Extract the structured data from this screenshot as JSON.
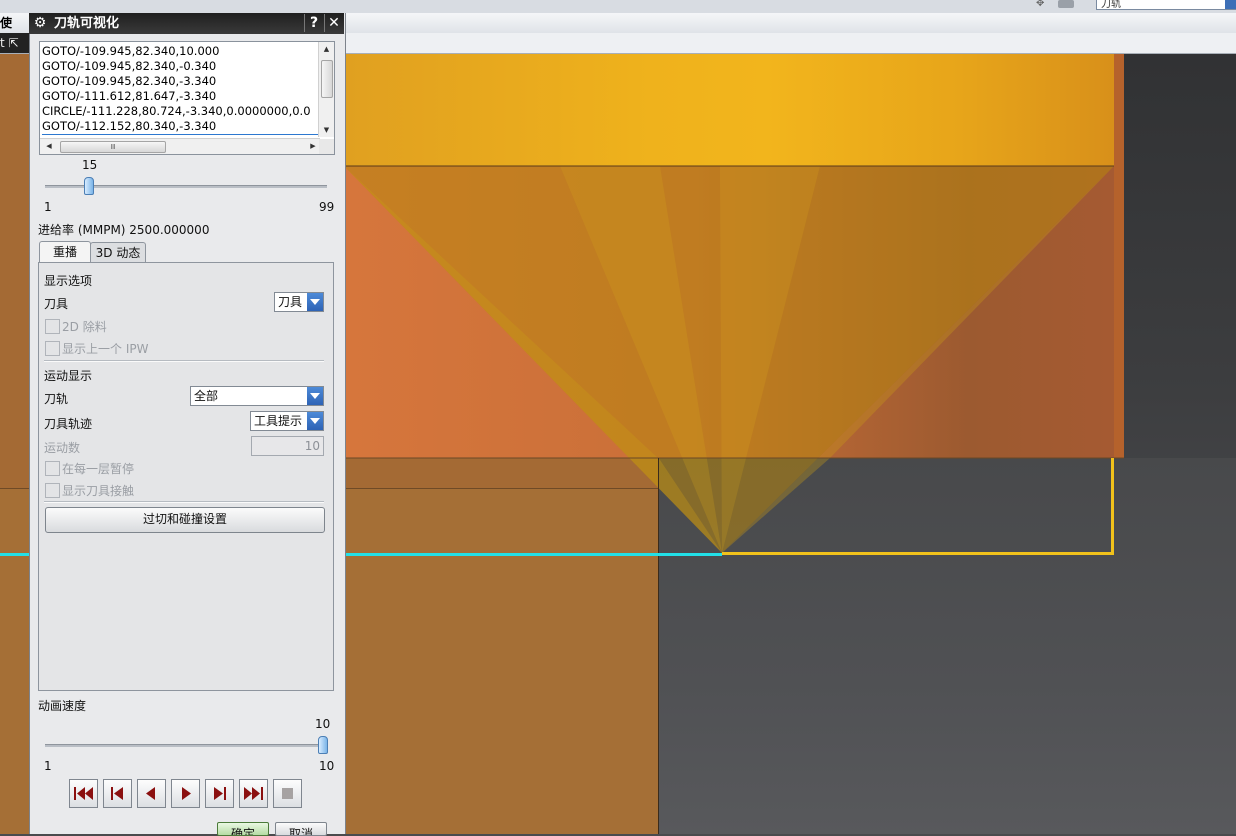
{
  "dialog": {
    "title": "刀轨可视化",
    "help_label": "?",
    "close_label": "✕",
    "gear_icon": "gear-icon",
    "toolpath_lines": [
      "GOTO/-109.945,82.340,10.000",
      "GOTO/-109.945,82.340,-0.340",
      "GOTO/-109.945,82.340,-3.340",
      "GOTO/-111.612,81.647,-3.340",
      "CIRCLE/-111.228,80.724,-3.340,0.0000000,0.0",
      "GOTO/-112.152,80.340,-3.340"
    ],
    "hscroll_grip": "Ⅲ",
    "position_slider": {
      "value_label": "15",
      "min_label": "1",
      "max_label": "99",
      "value": 15,
      "min": 1,
      "max": 99
    },
    "feed_rate": "进给率 (MMPM) 2500.000000",
    "tabs": [
      {
        "label": "重播",
        "active": true
      },
      {
        "label": "3D 动态",
        "active": false
      }
    ],
    "display_options": {
      "section_title": "显示选项",
      "tool_label": "刀具",
      "tool_value": "刀具",
      "chk_2d_removal": "2D 除料",
      "chk_prev_ipw": "显示上一个 IPW"
    },
    "motion_display": {
      "section_title": "运动显示",
      "toolpath_label": "刀轨",
      "toolpath_value": "全部",
      "tool_trace_label": "刀具轨迹",
      "tool_trace_value": "工具提示",
      "motion_count_label": "运动数",
      "motion_count_value": "10",
      "chk_pause_each_layer": "在每一层暂停",
      "chk_show_tool_contact": "显示刀具接触"
    },
    "gouge_button": "过切和碰撞设置",
    "animation_speed": {
      "label": "动画速度",
      "value_label": "10",
      "min_label": "1",
      "max_label": "10",
      "value": 10,
      "min": 1,
      "max": 10
    },
    "ok_label": "确定",
    "cancel_label": "取消"
  },
  "background_app": {
    "left_cut_text": "使用\"",
    "left_cut_text2": "t",
    "combo_partial": "刀轨"
  },
  "colors": {
    "tool_cone": "#d9a01a",
    "stock": "#a56f36",
    "part_top": "#efb21c",
    "cyan_path": "#22e0e8",
    "cut_outline": "#f2c21b"
  }
}
